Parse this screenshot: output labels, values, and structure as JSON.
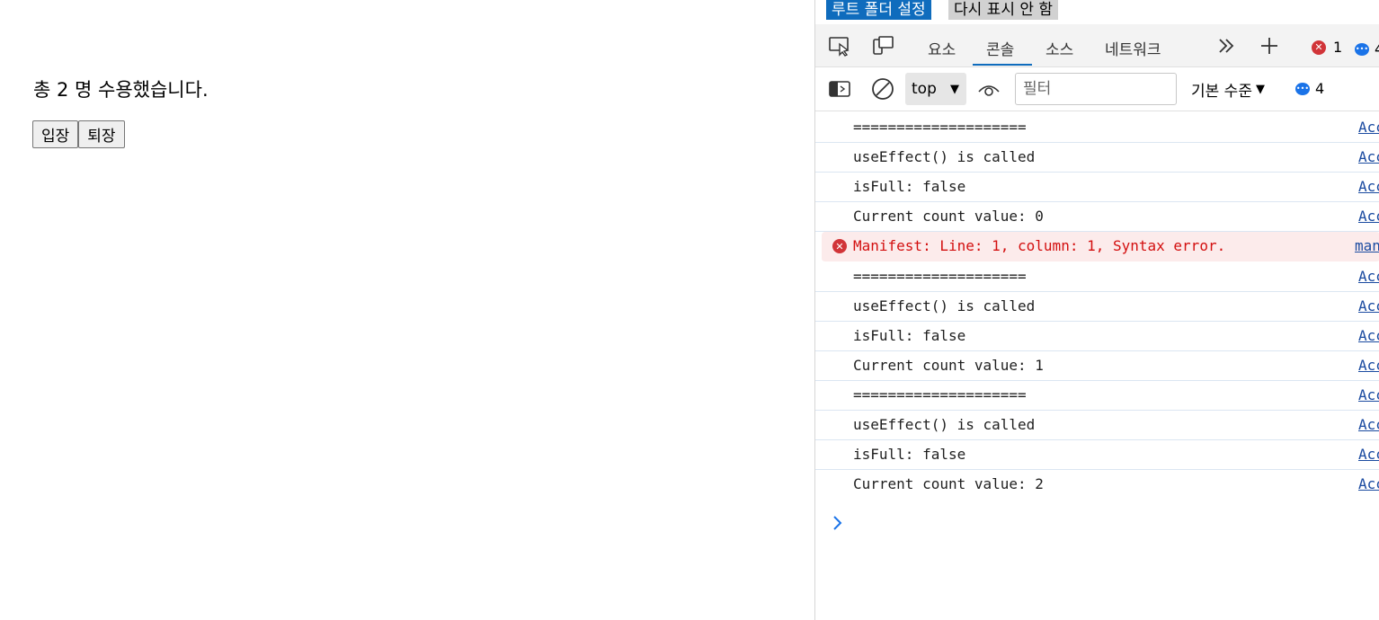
{
  "page": {
    "summary": "총 2 명 수용했습니다.",
    "buttons": {
      "enter": "입장",
      "exit": "퇴장"
    }
  },
  "devtools": {
    "infobar": {
      "primary": "루트 폴더 설정",
      "secondary": "다시 표시 안 함"
    },
    "tabs": [
      "요소",
      "콘솔",
      "소스",
      "네트워크"
    ],
    "active_tab": "콘솔",
    "error_count": "1",
    "message_count_top": "4",
    "toolbar": {
      "context": "top",
      "filter_placeholder": "필터",
      "level": "기본 수준",
      "message_count": "4"
    },
    "log": [
      {
        "text": "====================",
        "source": "Acc",
        "type": "log"
      },
      {
        "text": "useEffect() is called",
        "source": "Acc",
        "type": "log"
      },
      {
        "text": "isFull: false",
        "source": "Acc",
        "type": "log"
      },
      {
        "text": "Current count value: 0",
        "source": "Acc",
        "type": "log"
      },
      {
        "text": "Manifest: Line: 1, column: 1, Syntax error.",
        "source": "man",
        "type": "error"
      },
      {
        "text": "====================",
        "source": "Acc",
        "type": "log"
      },
      {
        "text": "useEffect() is called",
        "source": "Acc",
        "type": "log"
      },
      {
        "text": "isFull: false",
        "source": "Acc",
        "type": "log"
      },
      {
        "text": "Current count value: 1",
        "source": "Acc",
        "type": "log"
      },
      {
        "text": "====================",
        "source": "Acc",
        "type": "log"
      },
      {
        "text": "useEffect() is called",
        "source": "Acc",
        "type": "log"
      },
      {
        "text": "isFull: false",
        "source": "Acc",
        "type": "log"
      },
      {
        "text": "Current count value: 2",
        "source": "Acc",
        "type": "log"
      }
    ],
    "colors": {
      "accent": "#0f6cbd",
      "error": "#d13438",
      "link": "#1a4aa0"
    }
  }
}
